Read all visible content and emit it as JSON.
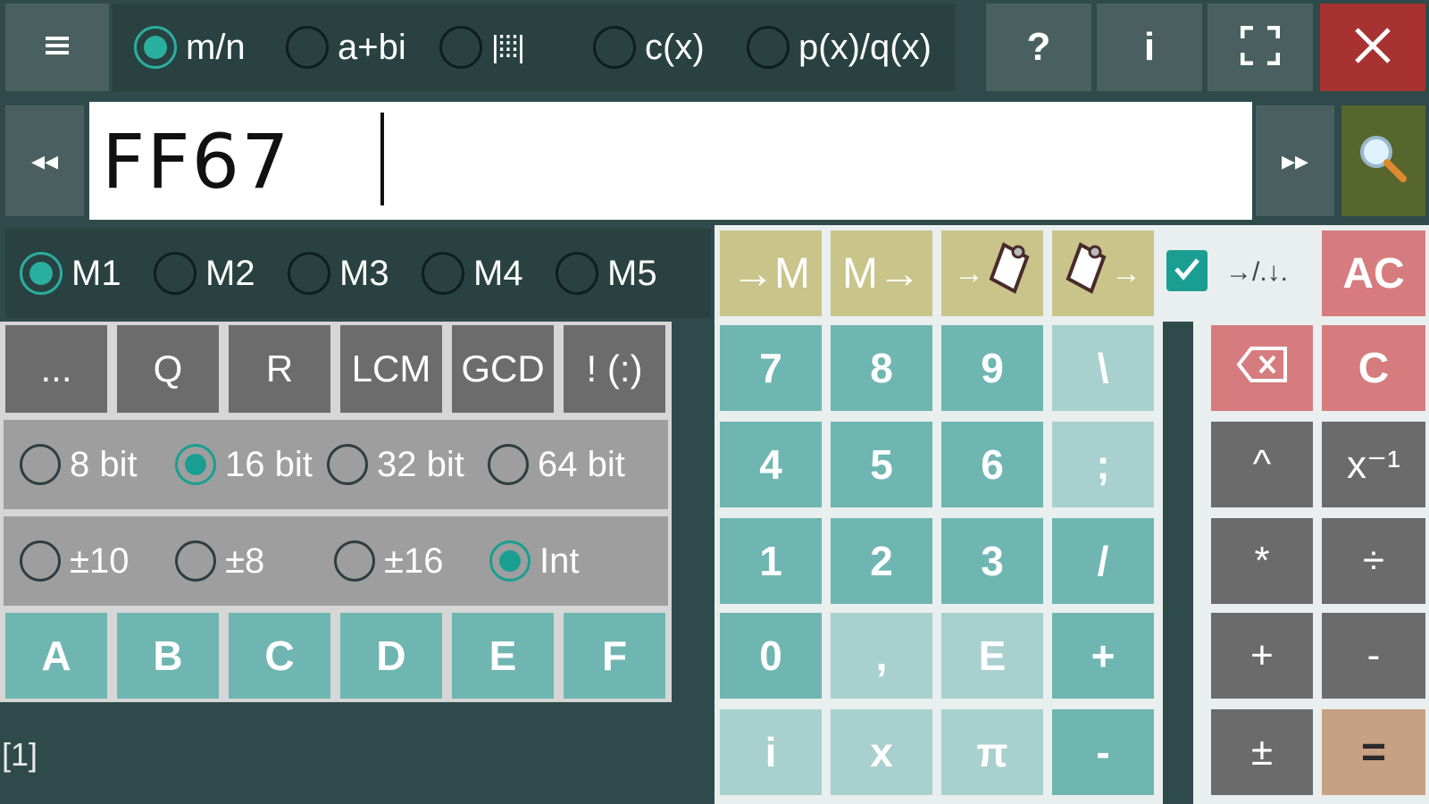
{
  "top": {
    "menu_icon": "hamburger-icon",
    "modes": [
      {
        "label": "m/n",
        "selected": true
      },
      {
        "label": "a+bi",
        "selected": false
      },
      {
        "label": "|⁞⁞⁞|",
        "selected": false
      },
      {
        "label": "c(x)",
        "selected": false
      },
      {
        "label": "p(x)/q(x)",
        "selected": false
      }
    ],
    "help_label": "?",
    "info_label": "i",
    "fullscreen_icon": "fullscreen-icon",
    "close_icon": "close-icon"
  },
  "input": {
    "value": "FF67",
    "left_nav": "◂◂",
    "right_nav": "▸▸",
    "search_icon": "search-icon"
  },
  "memory": {
    "slots": [
      {
        "label": "M1",
        "selected": true
      },
      {
        "label": "M2",
        "selected": false
      },
      {
        "label": "M3",
        "selected": false
      },
      {
        "label": "M4",
        "selected": false
      },
      {
        "label": "M5",
        "selected": false
      }
    ],
    "to_mem": "→M",
    "from_mem": "M→",
    "to_clip": "→",
    "from_clip": "→",
    "check_label": "→/.↓.",
    "ac": "AC"
  },
  "functions": [
    "...",
    "Q",
    "R",
    "LCM",
    "GCD",
    "! (:)"
  ],
  "bits": [
    {
      "label": "8 bit",
      "selected": false
    },
    {
      "label": "16 bit",
      "selected": true
    },
    {
      "label": "32 bit",
      "selected": false
    },
    {
      "label": "64 bit",
      "selected": false
    }
  ],
  "bases": [
    {
      "label": "±10",
      "selected": false
    },
    {
      "label": "±8",
      "selected": false
    },
    {
      "label": "±16",
      "selected": false
    },
    {
      "label": "Int",
      "selected": true
    }
  ],
  "hex": [
    "A",
    "B",
    "C",
    "D",
    "E",
    "F"
  ],
  "status": "[1]",
  "keypad": {
    "rows": [
      [
        "7",
        "8",
        "9",
        "\\"
      ],
      [
        "4",
        "5",
        "6",
        ";"
      ],
      [
        "1",
        "2",
        "3",
        "/"
      ],
      [
        "0",
        ",",
        "E",
        "+"
      ],
      [
        "i",
        "x",
        "π",
        "-"
      ]
    ]
  },
  "ops": {
    "backspace_icon": "backspace-icon",
    "c": "C",
    "pow": "^",
    "inv": "x⁻¹",
    "mul": "*",
    "div": "÷",
    "plus": "+",
    "minus": "-",
    "plusminus": "±",
    "equals": "="
  },
  "colors": {
    "accent": "#2aaea0",
    "close": "#b03030",
    "search": "#5a6a2a"
  }
}
